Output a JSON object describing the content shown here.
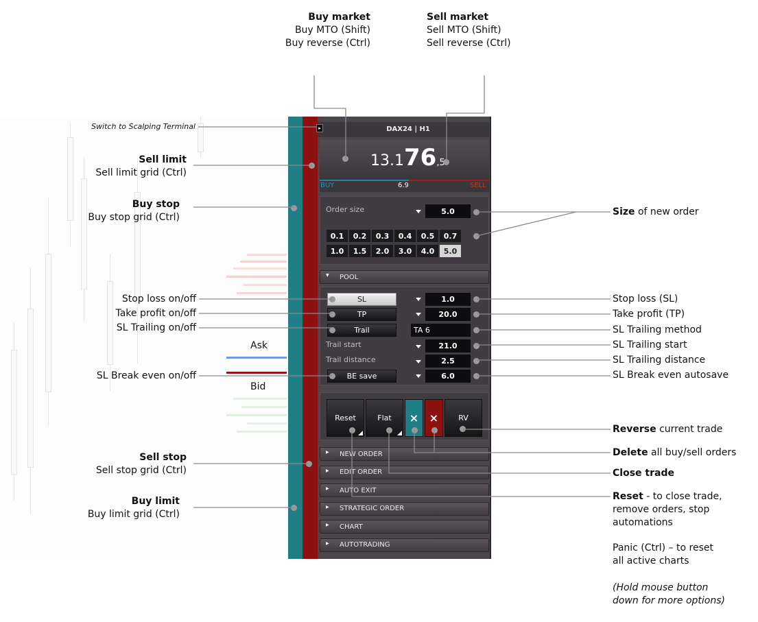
{
  "panel": {
    "symbol_title": "DAX24 | H1",
    "price": {
      "prefix": "13.1",
      "big": "76",
      "suffix": ",5"
    },
    "buy_label": "BUY",
    "sell_label": "SELL",
    "spread": "6.9",
    "order_size_label": "Order size",
    "order_size_value": "5.0",
    "size_buttons": [
      "0.1",
      "0.2",
      "0.3",
      "0.4",
      "0.5",
      "0.7",
      "1.0",
      "1.5",
      "2.0",
      "3.0",
      "4.0",
      "5.0"
    ],
    "selected_size": "5.0",
    "pool_label": "POOL",
    "sl_button": "SL",
    "sl_value": "1.0",
    "tp_button": "TP",
    "tp_value": "20.0",
    "trail_button": "Trail",
    "trail_method": "TA 6",
    "trail_start_label": "Trail start",
    "trail_start_value": "21.0",
    "trail_distance_label": "Trail distance",
    "trail_distance_value": "2.5",
    "be_button": "BE save",
    "be_value": "6.0",
    "reset_button": "Reset",
    "flat_button": "Flat",
    "delete_buy_icon": "×",
    "delete_sell_icon": "×",
    "rv_button": "RV",
    "sections": [
      "NEW ORDER",
      "EDIT ORDER",
      "AUTO EXIT",
      "STRATEGIC ORDER",
      "CHART",
      "AUTOTRADING"
    ]
  },
  "chart": {
    "ask_label": "Ask",
    "bid_label": "Bid",
    "ask_color": "#6a9fd6",
    "bid_color": "#8b1a1a"
  },
  "annotations": {
    "buy_market_title": "Buy market",
    "buy_market_l2": "Buy MTO (Shift)",
    "buy_market_l3": "Buy reverse (Ctrl)",
    "sell_market_title": "Sell market",
    "sell_market_l2": "Sell MTO (Shift)",
    "sell_market_l3": "Sell reverse (Ctrl)",
    "switch_terminal": "Switch to Scalping Terminal",
    "sell_limit_title": "Sell limit",
    "sell_limit_l2": "Sell limit grid (Ctrl)",
    "buy_stop_title": "Buy stop",
    "buy_stop_l2": "Buy stop grid (Ctrl)",
    "sl_onoff": "Stop loss on/off",
    "tp_onoff": "Take profit on/off",
    "trail_onoff": "SL Trailing on/off",
    "be_onoff": "SL Break even on/off",
    "sell_stop_title": "Sell stop",
    "sell_stop_l2": "Sell stop grid (Ctrl)",
    "buy_limit_title": "Buy limit",
    "buy_limit_l2": "Buy limit grid (Ctrl)",
    "size_bold": "Size",
    "size_rest": " of new order",
    "sl_desc": "Stop loss (SL)",
    "tp_desc": "Take profit (TP)",
    "trail_method_desc": "SL Trailing method",
    "trail_start_desc": "SL Trailing start",
    "trail_distance_desc": "SL Trailing distance",
    "be_desc": "SL Break even autosave",
    "reverse_bold": "Reverse",
    "reverse_rest": " current trade",
    "delete_bold": "Delete",
    "delete_rest": " all buy/sell orders",
    "close_trade": "Close trade",
    "reset_bold": "Reset",
    "reset_rest1": " - to close trade,",
    "reset_l2": "remove orders, stop",
    "reset_l3": "automations",
    "panic_l1": "Panic (Ctrl) – to reset",
    "panic_l2": "all active charts",
    "hold_l1": "(Hold mouse button",
    "hold_l2": "down for more options)"
  }
}
